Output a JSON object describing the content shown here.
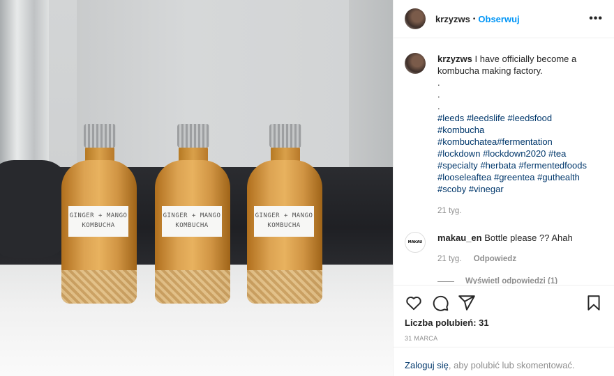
{
  "header": {
    "username": "krzyzws",
    "separator": "•",
    "follow_label": "Obserwuj",
    "more_label": "•••"
  },
  "photo": {
    "bottle_label_line1": "GINGER + MANGO",
    "bottle_label_line2": "KOMBUCHA"
  },
  "caption": {
    "username": "krzyzws",
    "text": "I have officially become a kombucha making factory.",
    "dots": [
      ".",
      ".",
      "."
    ],
    "hashtags": [
      "#leeds",
      "#leedslife",
      "#leedsfood",
      "#kombucha",
      "#kombuchatea",
      "#fermentation",
      "#lockdown",
      "#lockdown2020",
      "#tea",
      "#specialty",
      "#herbata",
      "#fermentedfoods",
      "#looseleaftea",
      "#greentea",
      "#guthealth",
      "#scoby",
      "#vinegar"
    ],
    "time": "21 tyg."
  },
  "comment": {
    "avatar_text": "MAKAU",
    "username": "makau_en",
    "text": "Bottle please ?? Ahah",
    "time": "21 tyg.",
    "reply_label": "Odpowiedz",
    "view_replies": "Wyświetl odpowiedzi (1)"
  },
  "actions": {
    "likes_label": "Liczba polubień: 31",
    "date": "31 MARCA"
  },
  "login": {
    "link": "Zaloguj się",
    "rest": ", aby polubić lub skomentować."
  }
}
